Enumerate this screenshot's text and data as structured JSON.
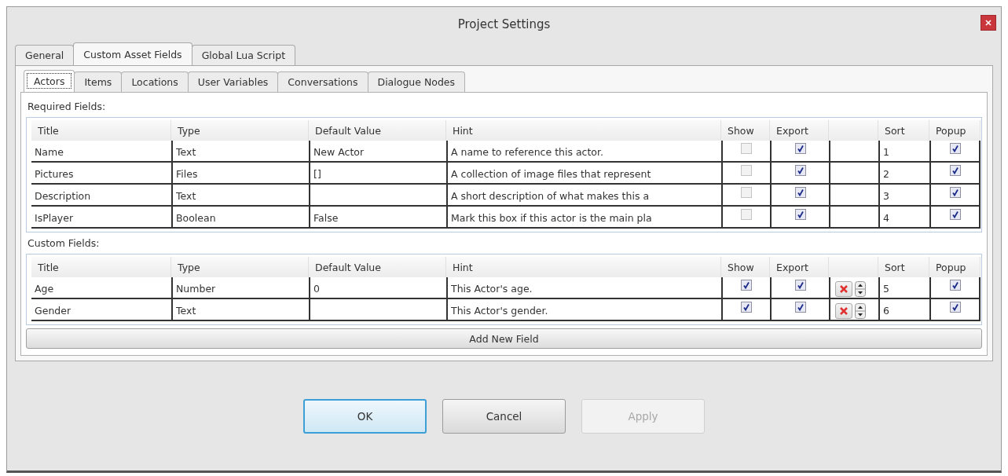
{
  "window": {
    "title": "Project Settings"
  },
  "tabs": [
    {
      "label": "General",
      "selected": false
    },
    {
      "label": "Custom Asset Fields",
      "selected": true
    },
    {
      "label": "Global Lua Script",
      "selected": false
    }
  ],
  "subtabs": [
    {
      "label": "Actors",
      "selected": true
    },
    {
      "label": "Items",
      "selected": false
    },
    {
      "label": "Locations",
      "selected": false
    },
    {
      "label": "User Variables",
      "selected": false
    },
    {
      "label": "Conversations",
      "selected": false
    },
    {
      "label": "Dialogue Nodes",
      "selected": false
    }
  ],
  "required_fields": {
    "label": "Required Fields:",
    "columns": [
      "Title",
      "Type",
      "Default Value",
      "Hint",
      "Show",
      "Export",
      "Sort",
      "Popup"
    ],
    "rows": [
      {
        "title": "Name",
        "type": "Text",
        "default_value": "New Actor",
        "hint": "A name to reference this actor.",
        "show": {
          "checked": false,
          "disabled": true
        },
        "export": {
          "checked": true,
          "disabled": false
        },
        "actions": false,
        "sort": "1",
        "popup": {
          "checked": true,
          "disabled": false
        }
      },
      {
        "title": "Pictures",
        "type": "Files",
        "default_value": "[]",
        "hint": "A collection of image files that represent",
        "show": {
          "checked": false,
          "disabled": true
        },
        "export": {
          "checked": true,
          "disabled": false
        },
        "actions": false,
        "sort": "2",
        "popup": {
          "checked": true,
          "disabled": false
        }
      },
      {
        "title": "Description",
        "type": "Text",
        "hint": "A short description of what makes this a",
        "show": {
          "checked": false,
          "disabled": true
        },
        "export": {
          "checked": true,
          "disabled": false
        },
        "actions": false,
        "sort": "3",
        "popup": {
          "checked": true,
          "disabled": false
        }
      },
      {
        "title": "IsPlayer",
        "type": "Boolean",
        "default_value": "False",
        "hint": "Mark this box if this actor is the main pla",
        "show": {
          "checked": false,
          "disabled": true
        },
        "export": {
          "checked": true,
          "disabled": false
        },
        "actions": false,
        "sort": "4",
        "popup": {
          "checked": true,
          "disabled": false
        }
      }
    ]
  },
  "custom_fields": {
    "label": "Custom Fields:",
    "columns": [
      "Title",
      "Type",
      "Default Value",
      "Hint",
      "Show",
      "Export",
      "Sort",
      "Popup"
    ],
    "rows": [
      {
        "title": "Age",
        "type": "Number",
        "default_value": "0",
        "hint": "This Actor's age.",
        "show": {
          "checked": true,
          "disabled": false
        },
        "export": {
          "checked": true,
          "disabled": false
        },
        "actions": true,
        "sort": "5",
        "popup": {
          "checked": true,
          "disabled": false
        }
      },
      {
        "title": "Gender",
        "type": "Text",
        "hint": "This Actor's gender.",
        "show": {
          "checked": true,
          "disabled": false
        },
        "export": {
          "checked": true,
          "disabled": false
        },
        "actions": true,
        "sort": "6",
        "popup": {
          "checked": true,
          "disabled": false
        }
      }
    ],
    "add_button": "Add New Field"
  },
  "buttons": [
    {
      "label": "OK",
      "default": true,
      "disabled": false
    },
    {
      "label": "Cancel",
      "default": false,
      "disabled": false
    },
    {
      "label": "Apply",
      "default": false,
      "disabled": true
    }
  ]
}
